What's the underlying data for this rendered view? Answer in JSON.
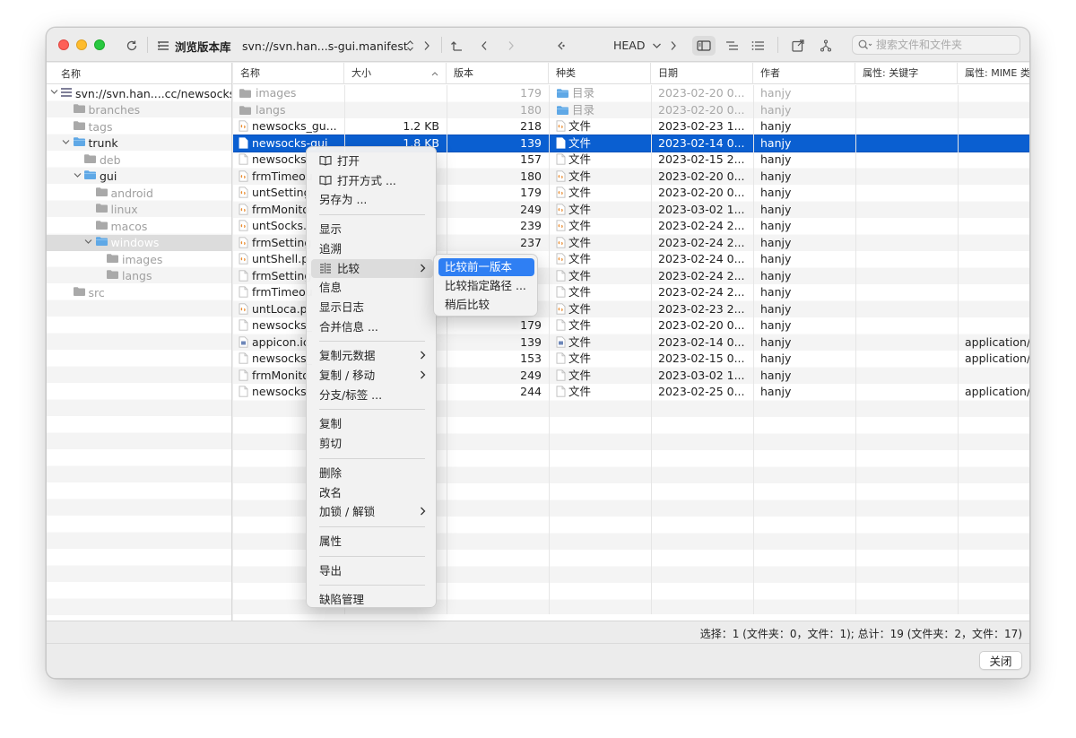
{
  "toolbar": {
    "title": "浏览版本库",
    "url": "svn://svn.han...s-gui.manifest",
    "revision": "HEAD",
    "search_placeholder": "搜索文件和文件夹"
  },
  "left_panel": {
    "header": "名称",
    "tree": [
      {
        "label": "svn://svn.han....cc/newsocks",
        "depth": 0,
        "chevron": "v",
        "icon": "repo-icon",
        "dim": false,
        "selected": false
      },
      {
        "label": "branches",
        "depth": 1,
        "chevron": "",
        "icon": "folder-icon",
        "dim": true,
        "selected": false
      },
      {
        "label": "tags",
        "depth": 1,
        "chevron": "",
        "icon": "folder-icon",
        "dim": true,
        "selected": false
      },
      {
        "label": "trunk",
        "depth": 1,
        "chevron": "v",
        "icon": "folder-open-icon",
        "dim": false,
        "selected": false
      },
      {
        "label": "deb",
        "depth": 2,
        "chevron": "",
        "icon": "folder-icon",
        "dim": true,
        "selected": false
      },
      {
        "label": "gui",
        "depth": 2,
        "chevron": "v",
        "icon": "folder-open-icon",
        "dim": false,
        "selected": false
      },
      {
        "label": "android",
        "depth": 3,
        "chevron": "",
        "icon": "folder-icon",
        "dim": true,
        "selected": false
      },
      {
        "label": "linux",
        "depth": 3,
        "chevron": "",
        "icon": "folder-icon",
        "dim": true,
        "selected": false
      },
      {
        "label": "macos",
        "depth": 3,
        "chevron": "",
        "icon": "folder-icon",
        "dim": true,
        "selected": false
      },
      {
        "label": "windows",
        "depth": 3,
        "chevron": "v",
        "icon": "folder-open-icon",
        "dim": false,
        "selected": true
      },
      {
        "label": "images",
        "depth": 4,
        "chevron": "",
        "icon": "folder-icon",
        "dim": true,
        "selected": false
      },
      {
        "label": "langs",
        "depth": 4,
        "chevron": "",
        "icon": "folder-icon",
        "dim": true,
        "selected": false
      },
      {
        "label": "src",
        "depth": 1,
        "chevron": "",
        "icon": "folder-icon",
        "dim": true,
        "selected": false
      }
    ]
  },
  "table": {
    "columns": [
      "名称",
      "大小",
      "版本",
      "种类",
      "日期",
      "作者",
      "属性: 关键字",
      "属性: MIME 类"
    ],
    "rows": [
      {
        "name": "images",
        "size": "",
        "rev": "179",
        "kind": "目录",
        "date": "2023-02-20 0...",
        "author": "hanjy",
        "keywords": "",
        "mime": "",
        "icon": "folder-icon",
        "dim": true,
        "selected": false
      },
      {
        "name": "langs",
        "size": "",
        "rev": "180",
        "kind": "目录",
        "date": "2023-02-20 0...",
        "author": "hanjy",
        "keywords": "",
        "mime": "",
        "icon": "folder-icon",
        "dim": true,
        "selected": false
      },
      {
        "name": "newsocks_gu...",
        "size": "1.2 KB",
        "rev": "218",
        "kind": "文件",
        "date": "2023-02-23 1...",
        "author": "hanjy",
        "keywords": "",
        "mime": "",
        "icon": "source-file-icon",
        "dim": false,
        "selected": false
      },
      {
        "name": "newsocks-gui",
        "size": "1.8 KB",
        "rev": "139",
        "kind": "文件",
        "date": "2023-02-14 0...",
        "author": "hanjy",
        "keywords": "",
        "mime": "",
        "icon": "doc-file-icon",
        "dim": false,
        "selected": true
      },
      {
        "name": "newsocks",
        "size": "",
        "rev": "157",
        "kind": "文件",
        "date": "2023-02-15 2...",
        "author": "hanjy",
        "keywords": "",
        "mime": "",
        "icon": "doc-file-icon",
        "dim": false,
        "selected": false
      },
      {
        "name": "frmTimeou",
        "size": "",
        "rev": "180",
        "kind": "文件",
        "date": "2023-02-20 0...",
        "author": "hanjy",
        "keywords": "",
        "mime": "",
        "icon": "source-file-icon",
        "dim": false,
        "selected": false
      },
      {
        "name": "untSetting",
        "size": "",
        "rev": "179",
        "kind": "文件",
        "date": "2023-02-20 0...",
        "author": "hanjy",
        "keywords": "",
        "mime": "",
        "icon": "source-file-icon",
        "dim": false,
        "selected": false
      },
      {
        "name": "frmMonito",
        "size": "",
        "rev": "249",
        "kind": "文件",
        "date": "2023-03-02 1...",
        "author": "hanjy",
        "keywords": "",
        "mime": "",
        "icon": "source-file-icon",
        "dim": false,
        "selected": false
      },
      {
        "name": "untSocks.",
        "size": "",
        "rev": "239",
        "kind": "文件",
        "date": "2023-02-24 2...",
        "author": "hanjy",
        "keywords": "",
        "mime": "",
        "icon": "source-file-icon",
        "dim": false,
        "selected": false
      },
      {
        "name": "frmSetting",
        "size": "",
        "rev": "237",
        "kind": "文件",
        "date": "2023-02-24 2...",
        "author": "hanjy",
        "keywords": "",
        "mime": "",
        "icon": "source-file-icon",
        "dim": false,
        "selected": false
      },
      {
        "name": "untShell.p",
        "size": "",
        "rev": "",
        "kind": "文件",
        "date": "2023-02-24 0...",
        "author": "hanjy",
        "keywords": "",
        "mime": "",
        "icon": "source-file-icon",
        "dim": false,
        "selected": false
      },
      {
        "name": "frmSetting",
        "size": "",
        "rev": "",
        "kind": "文件",
        "date": "2023-02-24 2...",
        "author": "hanjy",
        "keywords": "",
        "mime": "",
        "icon": "doc-file-icon",
        "dim": false,
        "selected": false
      },
      {
        "name": "frmTimeou",
        "size": "",
        "rev": "",
        "kind": "文件",
        "date": "2023-02-24 2...",
        "author": "hanjy",
        "keywords": "",
        "mime": "",
        "icon": "doc-file-icon",
        "dim": false,
        "selected": false
      },
      {
        "name": "untLoca.p",
        "size": "",
        "rev": "",
        "kind": "文件",
        "date": "2023-02-23 2...",
        "author": "hanjy",
        "keywords": "",
        "mime": "",
        "icon": "source-file-icon",
        "dim": false,
        "selected": false
      },
      {
        "name": "newsocks_",
        "size": "",
        "rev": "179",
        "kind": "文件",
        "date": "2023-02-20 0...",
        "author": "hanjy",
        "keywords": "",
        "mime": "",
        "icon": "doc-file-icon",
        "dim": false,
        "selected": false
      },
      {
        "name": "appicon.ic",
        "size": "",
        "rev": "139",
        "kind": "文件",
        "date": "2023-02-14 0...",
        "author": "hanjy",
        "keywords": "",
        "mime": "application/o",
        "icon": "image-file-icon",
        "dim": false,
        "selected": false
      },
      {
        "name": "newsocks_",
        "size": "",
        "rev": "153",
        "kind": "文件",
        "date": "2023-02-15 0...",
        "author": "hanjy",
        "keywords": "",
        "mime": "application/o",
        "icon": "doc-file-icon",
        "dim": false,
        "selected": false
      },
      {
        "name": "frmMonito",
        "size": "",
        "rev": "249",
        "kind": "文件",
        "date": "2023-03-02 1...",
        "author": "hanjy",
        "keywords": "",
        "mime": "",
        "icon": "doc-file-icon",
        "dim": false,
        "selected": false
      },
      {
        "name": "newsocks",
        "size": "",
        "rev": "244",
        "kind": "文件",
        "date": "2023-02-25 0...",
        "author": "hanjy",
        "keywords": "",
        "mime": "application/o",
        "icon": "doc-file-icon",
        "dim": false,
        "selected": false
      }
    ]
  },
  "context_menu": {
    "items": [
      {
        "label": "打开",
        "icon": "book-icon",
        "submenu": false,
        "highlight": false,
        "sep_before": false
      },
      {
        "label": "打开方式 ...",
        "icon": "book-icon",
        "submenu": false,
        "highlight": false,
        "sep_before": false
      },
      {
        "label": "另存为 ...",
        "icon": "",
        "submenu": false,
        "highlight": false,
        "sep_before": false
      },
      {
        "label": "显示",
        "icon": "",
        "submenu": false,
        "highlight": false,
        "sep_before": true
      },
      {
        "label": "追溯",
        "icon": "",
        "submenu": false,
        "highlight": false,
        "sep_before": false
      },
      {
        "label": "比较",
        "icon": "compare-icon",
        "submenu": true,
        "highlight": true,
        "sep_before": false
      },
      {
        "label": "信息",
        "icon": "",
        "submenu": false,
        "highlight": false,
        "sep_before": false
      },
      {
        "label": "显示日志",
        "icon": "",
        "submenu": false,
        "highlight": false,
        "sep_before": false
      },
      {
        "label": "合并信息 ...",
        "icon": "",
        "submenu": false,
        "highlight": false,
        "sep_before": false
      },
      {
        "label": "复制元数据",
        "icon": "",
        "submenu": true,
        "highlight": false,
        "sep_before": true
      },
      {
        "label": "复制 / 移动",
        "icon": "",
        "submenu": true,
        "highlight": false,
        "sep_before": false
      },
      {
        "label": "分支/标签 ...",
        "icon": "",
        "submenu": false,
        "highlight": false,
        "sep_before": false
      },
      {
        "label": "复制",
        "icon": "",
        "submenu": false,
        "highlight": false,
        "sep_before": true
      },
      {
        "label": "剪切",
        "icon": "",
        "submenu": false,
        "highlight": false,
        "sep_before": false
      },
      {
        "label": "删除",
        "icon": "",
        "submenu": false,
        "highlight": false,
        "sep_before": true
      },
      {
        "label": "改名",
        "icon": "",
        "submenu": false,
        "highlight": false,
        "sep_before": false
      },
      {
        "label": "加锁 / 解锁",
        "icon": "",
        "submenu": true,
        "highlight": false,
        "sep_before": false
      },
      {
        "label": "属性",
        "icon": "",
        "submenu": false,
        "highlight": false,
        "sep_before": true
      },
      {
        "label": "导出",
        "icon": "",
        "submenu": false,
        "highlight": false,
        "sep_before": true
      },
      {
        "label": "缺陷管理",
        "icon": "",
        "submenu": false,
        "highlight": false,
        "sep_before": true
      }
    ]
  },
  "compare_submenu": {
    "items": [
      {
        "label": "比较前一版本",
        "highlight": true
      },
      {
        "label": "比较指定路径 ...",
        "highlight": false
      },
      {
        "label": "稍后比较",
        "highlight": false
      }
    ]
  },
  "status": {
    "text": "选择：1 (文件夹：0，文件：1); 总计：19 (文件夹：2，文件：17)"
  },
  "close_label": "关闭",
  "colors": {
    "selection": "#0a5fd1",
    "folder": "#5fa8e6",
    "source_file_accent": "#e8892b",
    "submenu_highlight": "#2f7ff3"
  }
}
